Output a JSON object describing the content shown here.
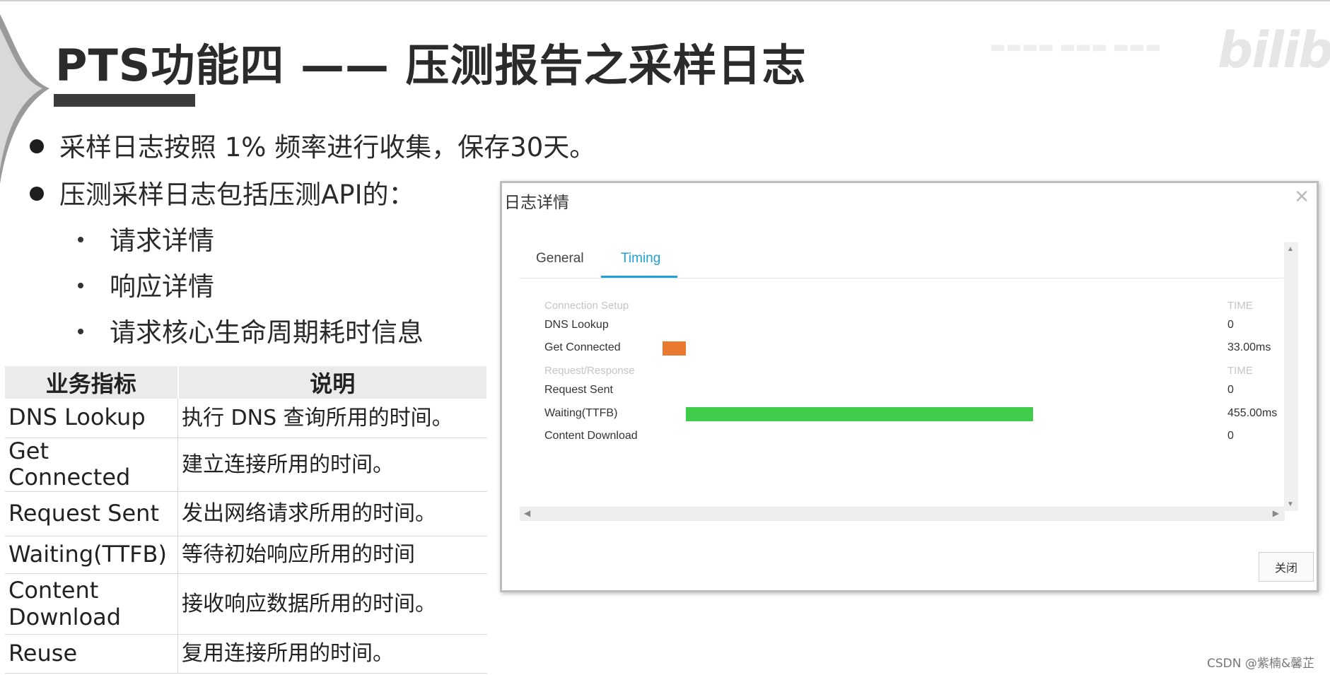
{
  "slide": {
    "title": "PTS功能四 —— 压测报告之采样日志",
    "watermark_logo": "bilibili",
    "bullets": [
      "采样日志按照 1% 频率进行收集，保存30天。",
      "压测采样日志包括压测API的："
    ],
    "sub_bullets": [
      "请求详情",
      "响应详情",
      "请求核心生命周期耗时信息"
    ],
    "csdn_watermark": "CSDN @紫楠&馨芷"
  },
  "table": {
    "headers": [
      "业务指标",
      "说明"
    ],
    "rows": [
      [
        "DNS Lookup",
        "执行 DNS 查询所用的时间。"
      ],
      [
        "Get Connected",
        "建立连接所用的时间。"
      ],
      [
        "Request Sent",
        "发出网络请求所用的时间。"
      ],
      [
        "Waiting(TTFB)",
        "等待初始响应所用的时间"
      ],
      [
        "Content Download",
        "接收响应数据所用的时间。"
      ],
      [
        "Reuse",
        "复用连接所用的时间。"
      ]
    ]
  },
  "dialog": {
    "title": "日志详情",
    "tabs": [
      "General",
      "Timing"
    ],
    "active_tab": "Timing",
    "sections": [
      {
        "label": "Connection Setup",
        "time_header": "TIME",
        "rows": [
          {
            "label": "DNS Lookup",
            "time": "0"
          },
          {
            "label": "Get Connected",
            "time": "33.00ms",
            "color": "#e8792e"
          }
        ]
      },
      {
        "label": "Request/Response",
        "time_header": "TIME",
        "rows": [
          {
            "label": "Request Sent",
            "time": "0"
          },
          {
            "label": "Waiting(TTFB)",
            "time": "455.00ms",
            "color": "#3fcc4a"
          },
          {
            "label": "Content Download",
            "time": "0"
          }
        ]
      }
    ],
    "close_button": "关闭",
    "colors": {
      "accent": "#20a0d8",
      "connect_bar": "#e8792e",
      "ttfb_bar": "#3fcc4a"
    }
  }
}
